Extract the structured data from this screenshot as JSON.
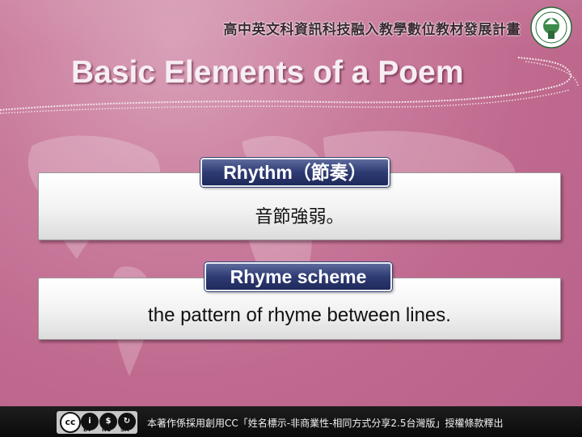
{
  "header": {
    "project_title": "高中英文科資訊科技融入教學數位教材發展計畫",
    "seal_text": "MINISTRY OF EDUCATION"
  },
  "slide": {
    "title": "Basic Elements of a Poem",
    "items": [
      {
        "label": "Rhythm（節奏）",
        "body": "音節強弱。"
      },
      {
        "label": "Rhyme scheme",
        "body": "the pattern of rhyme between lines."
      }
    ]
  },
  "footer": {
    "license_labels": [
      "BY",
      "NC",
      "SA"
    ],
    "license_text": "本著作係採用創用CC「姓名標示-非商業性-相同方式分享2.5台灣版」授權條款釋出"
  },
  "colors": {
    "background": "#c97b9c",
    "label_fill": "#2e3b73",
    "title_text": "#f7eef2"
  }
}
